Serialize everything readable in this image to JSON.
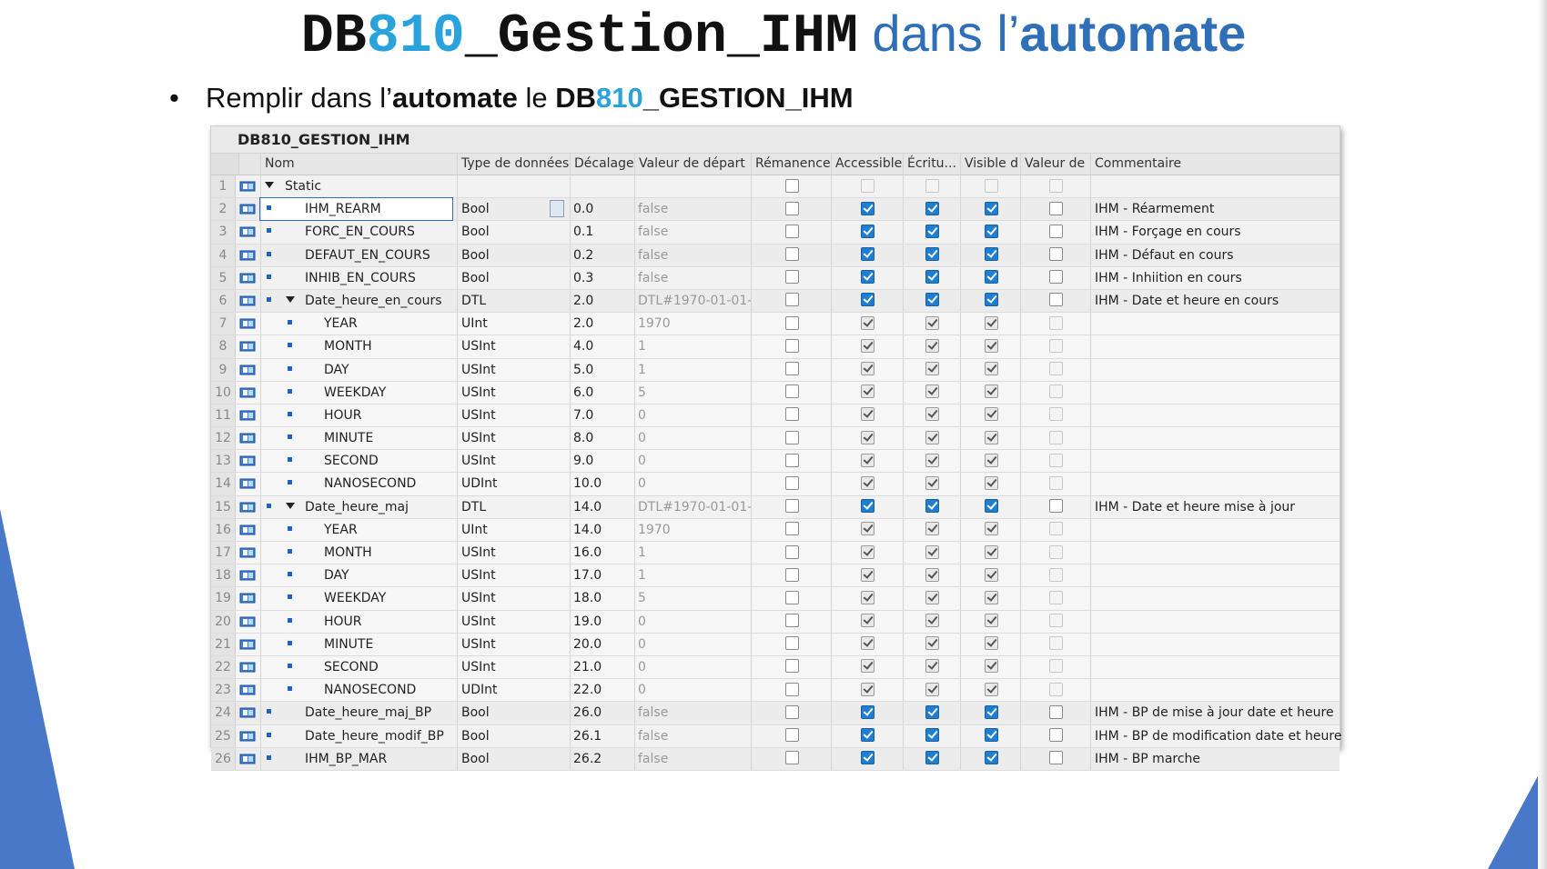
{
  "slide": {
    "title_code_a": "DB",
    "title_code_b": "810",
    "title_code_c": "_Gestion_IHM",
    "title_text_a": " dans l’",
    "title_text_b": "automate",
    "bullet_a": "Remplir dans l’",
    "bullet_b": "automate",
    "bullet_c": " le ",
    "bullet_d": "DB",
    "bullet_e": "810",
    "bullet_f": "_GESTION_IHM"
  },
  "colors": {
    "accent_blue": "#2aa3dc",
    "title_blue": "#2f6fb8",
    "checkbox_blue": "#1e7fd2",
    "corner_blue": "#4a78c8"
  },
  "panel": {
    "title": "DB810_GESTION_IHM"
  },
  "columns": {
    "nom": "Nom",
    "type": "Type de données",
    "offset": "Décalage",
    "start": "Valeur de départ",
    "retain": "Rémanence",
    "accessible": "Accessible",
    "writable": "Écritu...",
    "visible": "Visible d",
    "setpoint": "Valeur de",
    "comment": "Commentaire"
  },
  "rows": [
    {
      "n": "1",
      "level": 0,
      "expand": true,
      "name": "Static",
      "type": "",
      "offset": "",
      "start": "",
      "checks": "empty",
      "comment": ""
    },
    {
      "n": "2",
      "level": 1,
      "expand": false,
      "name": "IHM_REARM",
      "type": "Bool",
      "offset": "0.0",
      "start": "false",
      "checks": "top",
      "comment": "IHM - Réarmement",
      "selected": true
    },
    {
      "n": "3",
      "level": 1,
      "expand": false,
      "name": "FORC_EN_COURS",
      "type": "Bool",
      "offset": "0.1",
      "start": "false",
      "checks": "top",
      "comment": "IHM - Forçage en cours"
    },
    {
      "n": "4",
      "level": 1,
      "expand": false,
      "name": "DEFAUT_EN_COURS",
      "type": "Bool",
      "offset": "0.2",
      "start": "false",
      "checks": "top",
      "comment": "IHM - Défaut en cours"
    },
    {
      "n": "5",
      "level": 1,
      "expand": false,
      "name": "INHIB_EN_COURS",
      "type": "Bool",
      "offset": "0.3",
      "start": "false",
      "checks": "top",
      "comment": "IHM - Inhiition en cours"
    },
    {
      "n": "6",
      "level": 1,
      "expand": true,
      "name": "Date_heure_en_cours",
      "type": "DTL",
      "offset": "2.0",
      "start": "DTL#1970-01-01-",
      "checks": "top",
      "comment": "IHM - Date et heure en cours"
    },
    {
      "n": "7",
      "level": 2,
      "expand": false,
      "name": "YEAR",
      "type": "UInt",
      "offset": "2.0",
      "start": "1970",
      "checks": "sub",
      "comment": ""
    },
    {
      "n": "8",
      "level": 2,
      "expand": false,
      "name": "MONTH",
      "type": "USInt",
      "offset": "4.0",
      "start": "1",
      "checks": "sub",
      "comment": ""
    },
    {
      "n": "9",
      "level": 2,
      "expand": false,
      "name": "DAY",
      "type": "USInt",
      "offset": "5.0",
      "start": "1",
      "checks": "sub",
      "comment": ""
    },
    {
      "n": "10",
      "level": 2,
      "expand": false,
      "name": "WEEKDAY",
      "type": "USInt",
      "offset": "6.0",
      "start": "5",
      "checks": "sub",
      "comment": ""
    },
    {
      "n": "11",
      "level": 2,
      "expand": false,
      "name": "HOUR",
      "type": "USInt",
      "offset": "7.0",
      "start": "0",
      "checks": "sub",
      "comment": ""
    },
    {
      "n": "12",
      "level": 2,
      "expand": false,
      "name": "MINUTE",
      "type": "USInt",
      "offset": "8.0",
      "start": "0",
      "checks": "sub",
      "comment": ""
    },
    {
      "n": "13",
      "level": 2,
      "expand": false,
      "name": "SECOND",
      "type": "USInt",
      "offset": "9.0",
      "start": "0",
      "checks": "sub",
      "comment": ""
    },
    {
      "n": "14",
      "level": 2,
      "expand": false,
      "name": "NANOSECOND",
      "type": "UDInt",
      "offset": "10.0",
      "start": "0",
      "checks": "sub",
      "comment": ""
    },
    {
      "n": "15",
      "level": 1,
      "expand": true,
      "name": "Date_heure_maj",
      "type": "DTL",
      "offset": "14.0",
      "start": "DTL#1970-01-01-",
      "checks": "top",
      "comment": "IHM - Date et heure mise à jour"
    },
    {
      "n": "16",
      "level": 2,
      "expand": false,
      "name": "YEAR",
      "type": "UInt",
      "offset": "14.0",
      "start": "1970",
      "checks": "sub",
      "comment": ""
    },
    {
      "n": "17",
      "level": 2,
      "expand": false,
      "name": "MONTH",
      "type": "USInt",
      "offset": "16.0",
      "start": "1",
      "checks": "sub",
      "comment": ""
    },
    {
      "n": "18",
      "level": 2,
      "expand": false,
      "name": "DAY",
      "type": "USInt",
      "offset": "17.0",
      "start": "1",
      "checks": "sub",
      "comment": ""
    },
    {
      "n": "19",
      "level": 2,
      "expand": false,
      "name": "WEEKDAY",
      "type": "USInt",
      "offset": "18.0",
      "start": "5",
      "checks": "sub",
      "comment": ""
    },
    {
      "n": "20",
      "level": 2,
      "expand": false,
      "name": "HOUR",
      "type": "USInt",
      "offset": "19.0",
      "start": "0",
      "checks": "sub",
      "comment": ""
    },
    {
      "n": "21",
      "level": 2,
      "expand": false,
      "name": "MINUTE",
      "type": "USInt",
      "offset": "20.0",
      "start": "0",
      "checks": "sub",
      "comment": ""
    },
    {
      "n": "22",
      "level": 2,
      "expand": false,
      "name": "SECOND",
      "type": "USInt",
      "offset": "21.0",
      "start": "0",
      "checks": "sub",
      "comment": ""
    },
    {
      "n": "23",
      "level": 2,
      "expand": false,
      "name": "NANOSECOND",
      "type": "UDInt",
      "offset": "22.0",
      "start": "0",
      "checks": "sub",
      "comment": ""
    },
    {
      "n": "24",
      "level": 1,
      "expand": false,
      "name": "Date_heure_maj_BP",
      "type": "Bool",
      "offset": "26.0",
      "start": "false",
      "checks": "top",
      "comment": "IHM - BP de mise à jour date et heure"
    },
    {
      "n": "25",
      "level": 1,
      "expand": false,
      "name": "Date_heure_modif_BP",
      "type": "Bool",
      "offset": "26.1",
      "start": "false",
      "checks": "top",
      "comment": "IHM - BP de modification date et heure"
    },
    {
      "n": "26",
      "level": 1,
      "expand": false,
      "name": "IHM_BP_MAR",
      "type": "Bool",
      "offset": "26.2",
      "start": "false",
      "checks": "top",
      "comment": "IHM - BP marche"
    }
  ]
}
